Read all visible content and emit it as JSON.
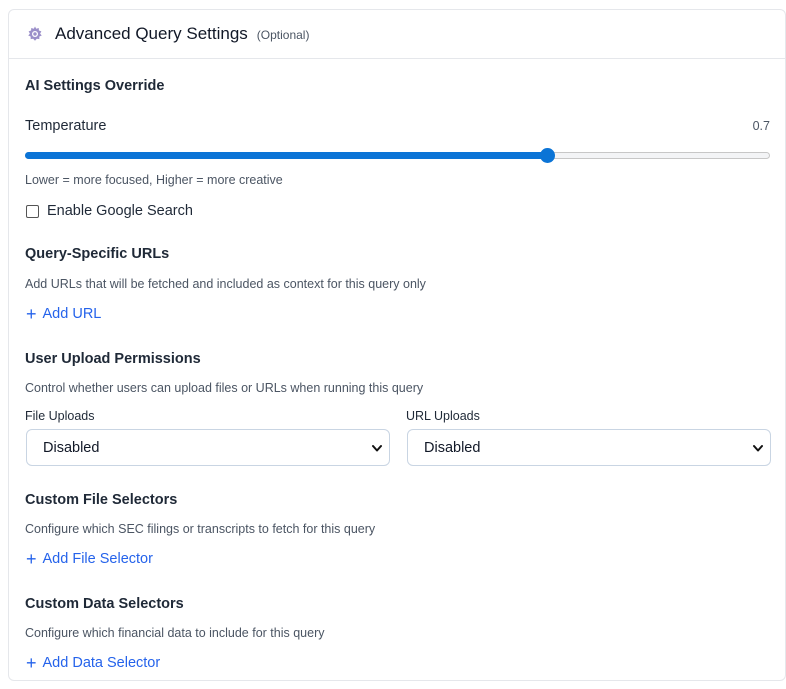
{
  "header": {
    "title": "Advanced Query Settings",
    "optional": "(Optional)",
    "icon": "gear-icon"
  },
  "ai_settings": {
    "title": "AI Settings Override",
    "temperature_label": "Temperature",
    "temperature_value": "0.7",
    "temperature_fraction": 0.7,
    "hint": "Lower = more focused, Higher = more creative",
    "google_search_label": "Enable Google Search",
    "google_search_checked": false
  },
  "urls": {
    "title": "Query-Specific URLs",
    "desc": "Add URLs that will be fetched and included as context for this query only",
    "add_label": "Add URL"
  },
  "permissions": {
    "title": "User Upload Permissions",
    "desc": "Control whether users can upload files or URLs when running this query",
    "file_uploads_label": "File Uploads",
    "file_uploads_value": "Disabled",
    "url_uploads_label": "URL Uploads",
    "url_uploads_value": "Disabled"
  },
  "file_selectors": {
    "title": "Custom File Selectors",
    "desc": "Configure which SEC filings or transcripts to fetch for this query",
    "add_label": "Add File Selector"
  },
  "data_selectors": {
    "title": "Custom Data Selectors",
    "desc": "Configure which financial data to include for this query",
    "add_label": "Add Data Selector"
  },
  "colors": {
    "accent": "#0b74d6",
    "link": "#2563eb",
    "border": "#e5e7eb"
  }
}
